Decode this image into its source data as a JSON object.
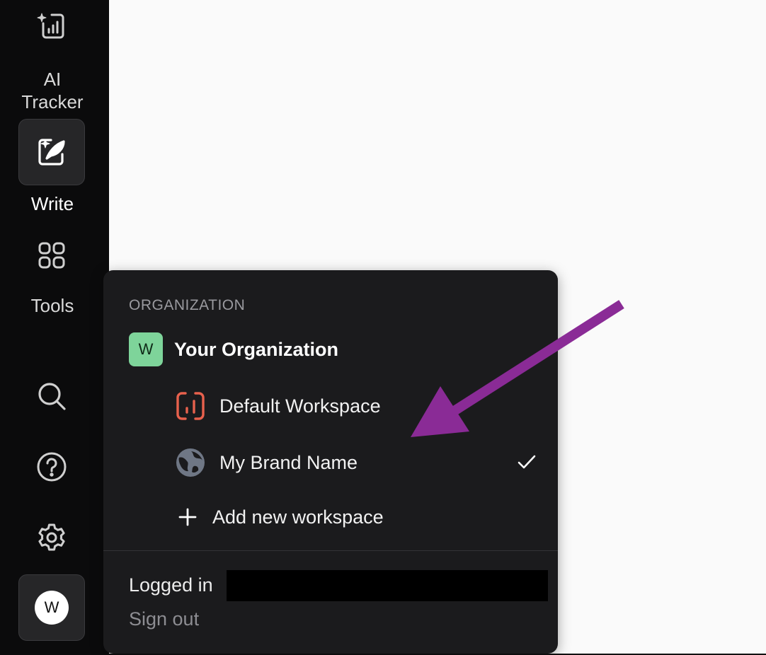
{
  "sidebar": {
    "items": [
      {
        "label": "AI\nTracker",
        "icon": "chart-sparkle-icon"
      },
      {
        "label": "Write",
        "icon": "write-feather-icon",
        "active": true
      },
      {
        "label": "Tools",
        "icon": "grid-icon"
      }
    ],
    "search_icon": "search-icon",
    "help_icon": "help-icon",
    "settings_icon": "gear-icon",
    "avatar_initial": "W"
  },
  "popup": {
    "section_label": "ORGANIZATION",
    "org": {
      "initial": "W",
      "name": "Your Organization",
      "badge_color": "#7ed49a"
    },
    "workspaces": [
      {
        "label": "Default Workspace",
        "icon": "workspace-logo-icon",
        "icon_color": "#e8614d",
        "selected": false
      },
      {
        "label": "My Brand Name",
        "icon": "globe-icon",
        "selected": true
      }
    ],
    "add_workspace_label": "Add new workspace",
    "logged_in_label": "Logged in",
    "sign_out_label": "Sign out"
  },
  "colors": {
    "sidebar_bg": "#0b0b0c",
    "popup_bg": "#1b1b1d",
    "arrow": "#8a2b96"
  }
}
